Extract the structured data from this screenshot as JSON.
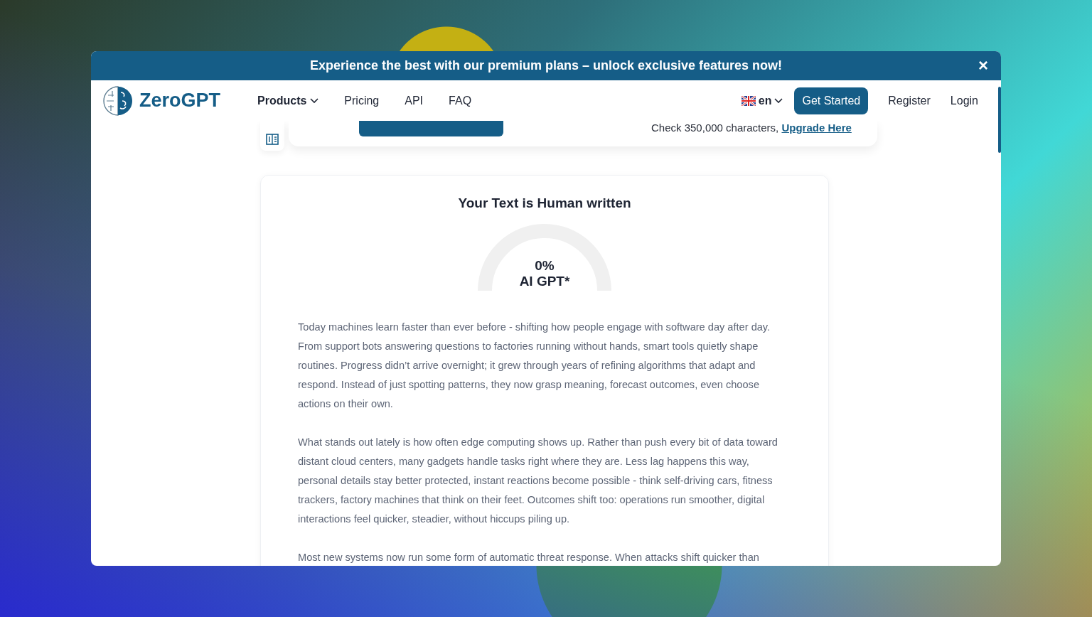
{
  "banner": {
    "text": "Experience the best with our premium plans – unlock exclusive features now!",
    "close": "×"
  },
  "nav": {
    "logo": "ZeroGPT",
    "links": [
      {
        "label": "Products",
        "dropdown": true
      },
      {
        "label": "Pricing",
        "dropdown": false
      },
      {
        "label": "API",
        "dropdown": false
      },
      {
        "label": "FAQ",
        "dropdown": false
      }
    ],
    "language": "en",
    "cta": "Get Started",
    "register": "Register",
    "login": "Login"
  },
  "detector": {
    "limit_text": "Check 350,000 characters,",
    "upgrade_link": "Upgrade Here"
  },
  "result": {
    "title": "Your Text is Human written",
    "gauge": {
      "percent": "0%",
      "label": "AI GPT*"
    },
    "paragraphs": [
      "Today machines learn faster than ever before - shifting how people engage with software day after day. From support bots answering questions to factories running without hands, smart tools quietly shape routines. Progress didn’t arrive overnight; it grew through years of refining algorithms that adapt and respond. Instead of just spotting patterns, they now grasp meaning, forecast outcomes, even choose actions on their own.",
      "What stands out lately is how often edge computing shows up. Rather than push every bit of data toward distant cloud centers, many gadgets handle tasks right where they are. Less lag happens this way, personal details stay better protected, instant reactions become possible - think self-driving cars, fitness trackers, factory machines that think on their feet. Outcomes shift too: operations run smoother, digital interactions feel quicker, steadier, without hiccups piling up.",
      "Most new systems now run some form of automatic threat response. When attacks shift quicker than"
    ]
  }
}
